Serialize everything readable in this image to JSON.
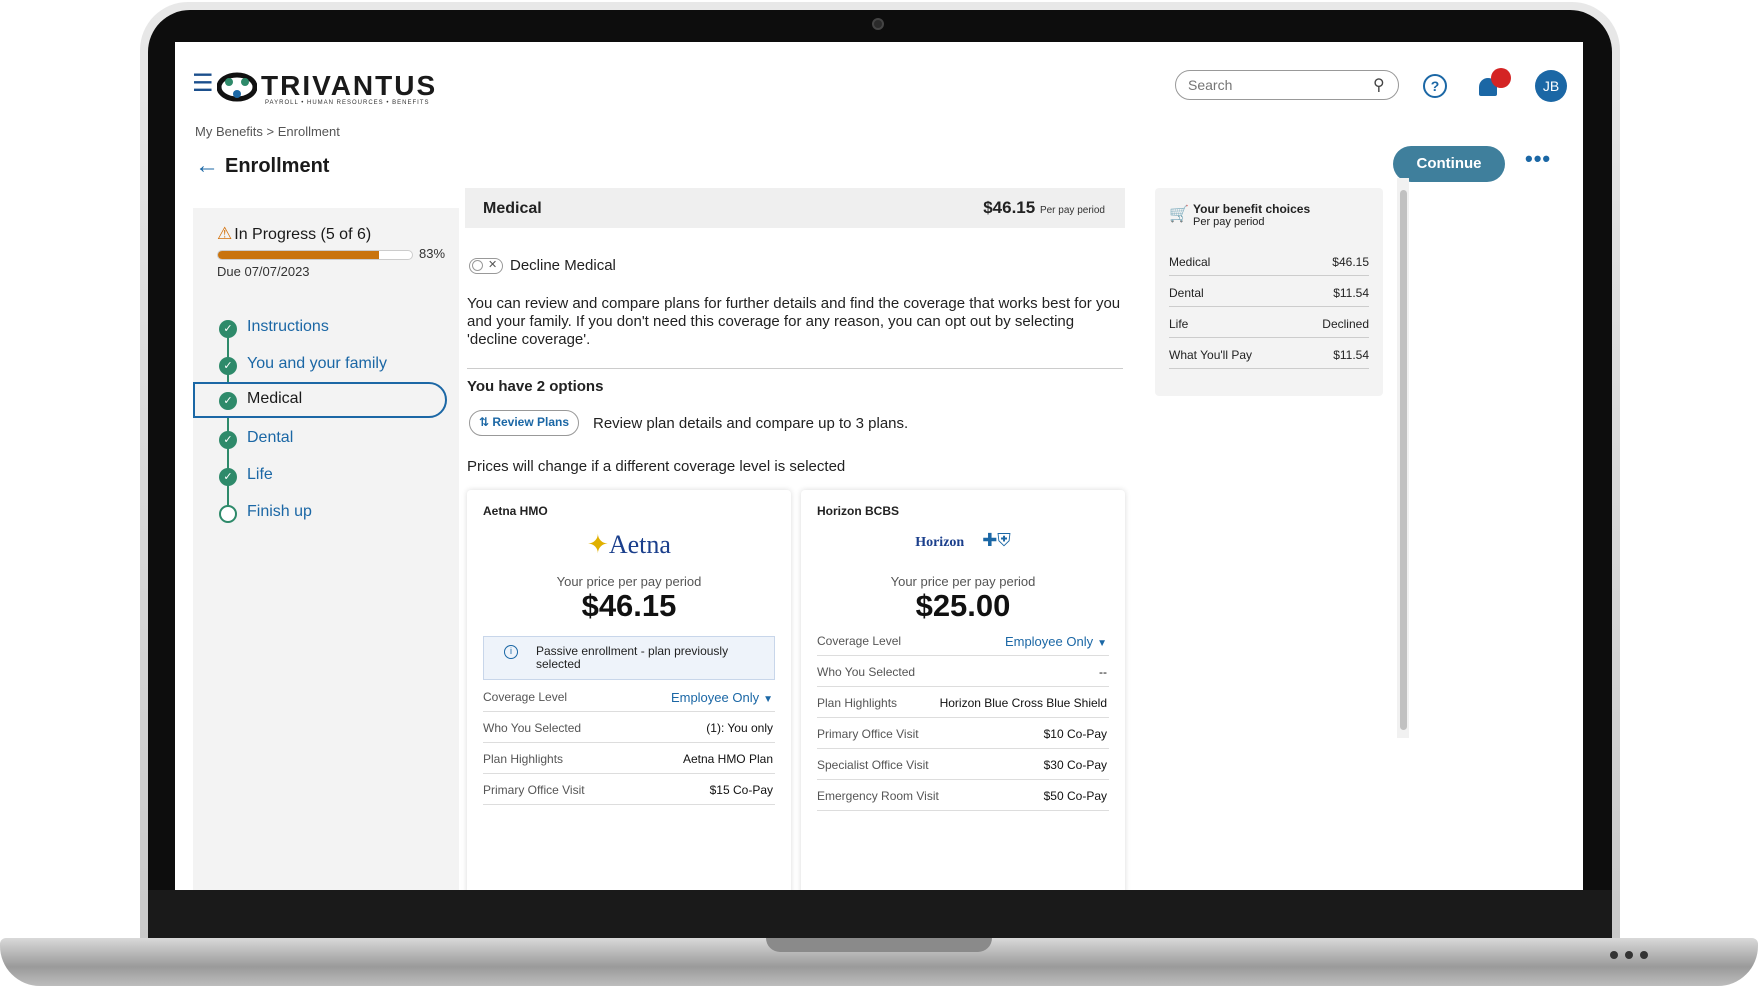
{
  "brand": {
    "name": "TRIVANTUS",
    "tagline": "PAYROLL • HUMAN RESOURCES • BENEFITS"
  },
  "header": {
    "search_placeholder": "Search",
    "avatar_initials": "JB"
  },
  "breadcrumb": "My Benefits > Enrollment",
  "page_title": "Enrollment",
  "continue_label": "Continue",
  "progress": {
    "status": "In Progress (5 of 6)",
    "percent": 83,
    "percent_label": "83%",
    "due": "Due 07/07/2023",
    "steps": [
      {
        "label": "Instructions",
        "done": true,
        "active": false
      },
      {
        "label": "You and your family",
        "done": true,
        "active": false
      },
      {
        "label": "Medical",
        "done": true,
        "active": true
      },
      {
        "label": "Dental",
        "done": true,
        "active": false
      },
      {
        "label": "Life",
        "done": true,
        "active": false
      },
      {
        "label": "Finish up",
        "done": false,
        "active": false
      }
    ]
  },
  "medical": {
    "title": "Medical",
    "price": "$46.15",
    "price_unit": "Per pay period",
    "decline_label": "Decline Medical",
    "intro": "You can review and compare plans for further details and find the coverage that works best for you and your family. If you don't need this coverage for any reason, you can opt out by selecting 'decline coverage'.",
    "options_title": "You have 2 options",
    "review_button": "Review Plans",
    "review_desc": "Review plan details and compare up to 3 plans.",
    "price_note": "Prices will change if a different coverage level is selected"
  },
  "plans": [
    {
      "name": "Aetna HMO",
      "logo_text": "Aetna",
      "price_label": "Your price per pay period",
      "price": "$46.15",
      "notice": "Passive enrollment - plan previously selected",
      "rows": [
        {
          "k": "Coverage Level",
          "v": "Employee Only"
        },
        {
          "k": "Who You Selected",
          "v": "(1): You only"
        },
        {
          "k": "Plan Highlights",
          "v": "Aetna HMO Plan"
        },
        {
          "k": "Primary Office Visit",
          "v": "$15 Co-Pay"
        }
      ]
    },
    {
      "name": "Horizon BCBS",
      "logo_text": "Horizon",
      "price_label": "Your price per pay period",
      "price": "$25.00",
      "rows": [
        {
          "k": "Coverage Level",
          "v": "Employee Only"
        },
        {
          "k": "Who You Selected",
          "v": "--"
        },
        {
          "k": "Plan Highlights",
          "v": "Horizon Blue Cross Blue Shield"
        },
        {
          "k": "Primary Office Visit",
          "v": "$10 Co-Pay"
        },
        {
          "k": "Specialist Office Visit",
          "v": "$30 Co-Pay"
        },
        {
          "k": "Emergency Room Visit",
          "v": "$50 Co-Pay"
        }
      ]
    }
  ],
  "summary": {
    "title": "Your benefit choices",
    "subtitle": "Per pay period",
    "rows": [
      {
        "k": "Medical",
        "v": "$46.15"
      },
      {
        "k": "Dental",
        "v": "$11.54"
      },
      {
        "k": "Life",
        "v": "Declined"
      },
      {
        "k": "What You'll Pay",
        "v": "$11.54"
      }
    ]
  }
}
